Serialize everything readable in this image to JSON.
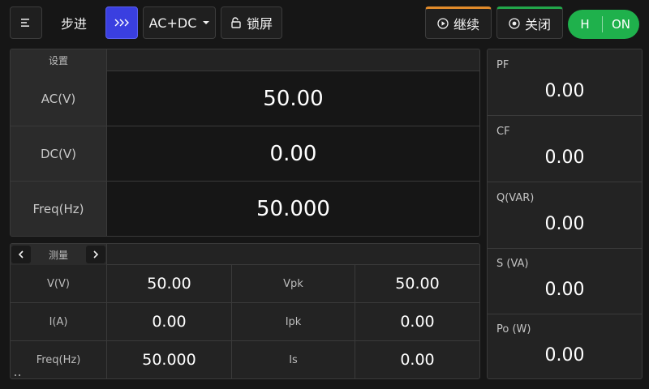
{
  "toolbar": {
    "mode_label": "步进",
    "source_selected": "AC+DC",
    "lock_label": "锁屏",
    "continue_label": "继续",
    "close_label": "关闭",
    "toggle_left": "H",
    "toggle_right": "ON",
    "colors": {
      "step_button": "#3a3fe0",
      "continue_accent": "#e08a2a",
      "close_accent": "#22a64a",
      "toggle_on": "#1fb14c"
    }
  },
  "settings": {
    "header": "设置",
    "rows": [
      {
        "label": "AC(V)",
        "value": "50.00"
      },
      {
        "label": "DC(V)",
        "value": "0.00"
      },
      {
        "label": "Freq(Hz)",
        "value": "50.000"
      }
    ]
  },
  "measure": {
    "header": "测量",
    "rows": [
      {
        "label1": "V(V)",
        "value1": "50.00",
        "label2": "Vpk",
        "value2": "50.00"
      },
      {
        "label1": "I(A)",
        "value1": "0.00",
        "label2": "Ipk",
        "value2": "0.00"
      },
      {
        "label1": "Freq(Hz)",
        "value1": "50.000",
        "label2": "Is",
        "value2": "0.00"
      }
    ]
  },
  "power": [
    {
      "label": "PF",
      "value": "0.00"
    },
    {
      "label": "CF",
      "value": "0.00"
    },
    {
      "label": "Q(VAR)",
      "value": "0.00"
    },
    {
      "label": "S (VA)",
      "value": "0.00"
    },
    {
      "label": "Po (W)",
      "value": "0.00"
    }
  ],
  "icons": {
    "menu": "menu-icon",
    "step": "triple-chevron-right-icon",
    "dropdown": "caret-down-icon",
    "lock": "unlock-icon",
    "continue": "play-circle-icon",
    "close": "stop-circle-icon",
    "prev": "chevron-left-icon",
    "next": "chevron-right-icon"
  }
}
